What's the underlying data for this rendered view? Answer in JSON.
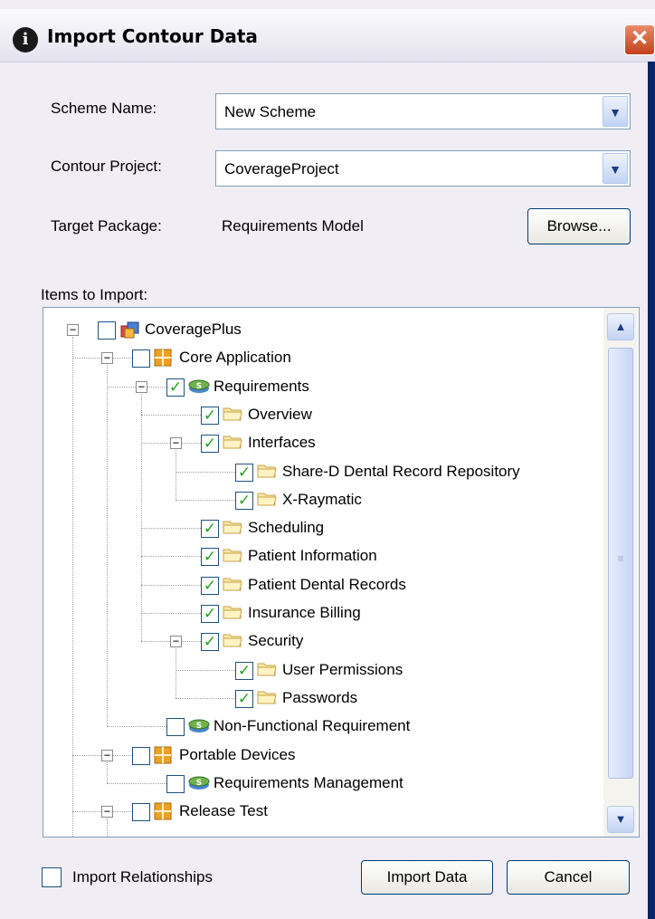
{
  "dialog": {
    "title": "Import Contour Data",
    "title_icon": "info-icon",
    "close_glyph": "✕"
  },
  "form": {
    "scheme_name_label": "Scheme Name:",
    "scheme_name_value": "New Scheme",
    "contour_project_label": "Contour Project:",
    "contour_project_value": "CoverageProject",
    "target_package_label": "Target Package:",
    "target_package_value": "Requirements Model",
    "browse_label": "Browse...",
    "dropdown_glyph": "▼"
  },
  "items": {
    "label": "Items to Import:",
    "tree": [
      {
        "label": "CoveragePlus",
        "icon": "package-cube-icon",
        "checked": false
      },
      {
        "label": "Core Application",
        "icon": "grid-package-icon",
        "checked": false
      },
      {
        "label": "Requirements",
        "icon": "requirement-icon",
        "checked": true
      },
      {
        "label": "Overview",
        "icon": "folder-icon",
        "checked": true
      },
      {
        "label": "Interfaces",
        "icon": "folder-icon",
        "checked": true
      },
      {
        "label": "Share-D Dental Record Repository",
        "icon": "folder-icon",
        "checked": true
      },
      {
        "label": "X-Raymatic",
        "icon": "folder-icon",
        "checked": true
      },
      {
        "label": "Scheduling",
        "icon": "folder-icon",
        "checked": true
      },
      {
        "label": "Patient Information",
        "icon": "folder-icon",
        "checked": true
      },
      {
        "label": "Patient Dental Records",
        "icon": "folder-icon",
        "checked": true
      },
      {
        "label": "Insurance Billing",
        "icon": "folder-icon",
        "checked": true
      },
      {
        "label": "Security",
        "icon": "folder-icon",
        "checked": true
      },
      {
        "label": "User Permissions",
        "icon": "folder-icon",
        "checked": true
      },
      {
        "label": "Passwords",
        "icon": "folder-icon",
        "checked": true
      },
      {
        "label": "Non-Functional Requirement",
        "icon": "requirement-icon",
        "checked": false
      },
      {
        "label": "Portable Devices",
        "icon": "grid-package-icon",
        "checked": false
      },
      {
        "label": "Requirements Management",
        "icon": "requirement-icon",
        "checked": false
      },
      {
        "label": "Release Test",
        "icon": "grid-package-icon",
        "checked": false
      }
    ],
    "check_glyph": "✓",
    "scroll_up_glyph": "▲",
    "scroll_down_glyph": "▼",
    "grip_glyph": "≡"
  },
  "footer": {
    "import_relationships_label": "Import Relationships",
    "import_relationships_checked": false,
    "import_button_label": "Import Data",
    "cancel_button_label": "Cancel"
  }
}
